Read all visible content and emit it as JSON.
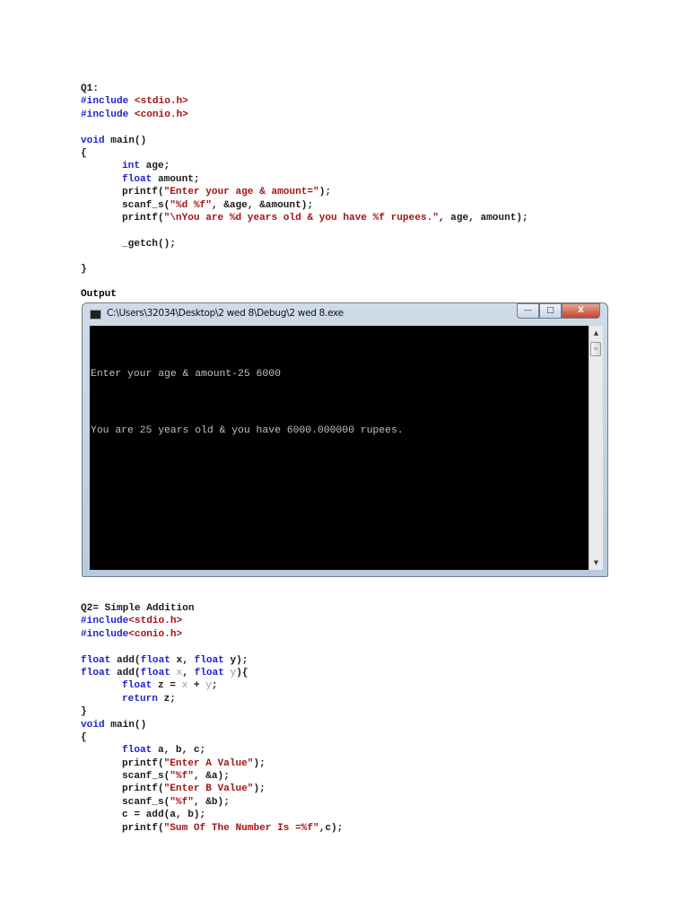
{
  "q1": {
    "lines": [
      [
        {
          "t": "Q1:",
          "c": "label"
        }
      ],
      [
        {
          "t": "#include ",
          "c": "kw"
        },
        {
          "t": "<stdio.h>",
          "c": "str"
        }
      ],
      [
        {
          "t": "#include ",
          "c": "kw"
        },
        {
          "t": "<conio.h>",
          "c": "str"
        }
      ],
      [],
      [
        {
          "t": "void",
          "c": "kw"
        },
        {
          "t": " main()",
          "c": ""
        }
      ],
      [
        {
          "t": "{",
          "c": ""
        }
      ],
      [
        {
          "t": "int",
          "c": "kw",
          "i": 1
        },
        {
          "t": " age;",
          "c": ""
        }
      ],
      [
        {
          "t": "float",
          "c": "kw",
          "i": 1
        },
        {
          "t": " amount;",
          "c": ""
        }
      ],
      [
        {
          "t": "printf(",
          "c": "",
          "i": 1
        },
        {
          "t": "\"Enter your age & amount=\"",
          "c": "str"
        },
        {
          "t": ");",
          "c": ""
        }
      ],
      [
        {
          "t": "scanf_s(",
          "c": "",
          "i": 1
        },
        {
          "t": "\"%d %f\"",
          "c": "str"
        },
        {
          "t": ", &age, &amount);",
          "c": ""
        }
      ],
      [
        {
          "t": "printf(",
          "c": "",
          "i": 1
        },
        {
          "t": "\"\\nYou are %d years old & you have %f rupees.\"",
          "c": "str"
        },
        {
          "t": ", age, amount);",
          "c": ""
        }
      ],
      [],
      [
        {
          "t": "_getch();",
          "c": "",
          "i": 1
        }
      ],
      [],
      [
        {
          "t": "}",
          "c": ""
        }
      ]
    ]
  },
  "output_label": "Output",
  "console_window": {
    "title": "C:\\Users\\32034\\Desktop\\2 wed 8\\Debug\\2 wed 8.exe",
    "minimize": "—",
    "maximize": "□",
    "close": "X",
    "output_lines": [
      "Enter your age & amount-25 6000",
      "You are 25 years old & you have 6000.000000 rupees."
    ],
    "scroll_up": "▲",
    "scroll_down": "▼",
    "thumb_grip": "≡"
  },
  "q2": {
    "lines": [
      [
        {
          "t": "Q2= Simple Addition",
          "c": "label"
        }
      ],
      [
        {
          "t": "#include",
          "c": "kw"
        },
        {
          "t": "<stdio.h>",
          "c": "str"
        }
      ],
      [
        {
          "t": "#include",
          "c": "kw"
        },
        {
          "t": "<conio.h>",
          "c": "str"
        }
      ],
      [],
      [
        {
          "t": "float",
          "c": "kw"
        },
        {
          "t": " add(",
          "c": ""
        },
        {
          "t": "float",
          "c": "kw"
        },
        {
          "t": " x, ",
          "c": ""
        },
        {
          "t": "float",
          "c": "kw"
        },
        {
          "t": " y);",
          "c": ""
        }
      ],
      [
        {
          "t": "float",
          "c": "kw"
        },
        {
          "t": " add(",
          "c": ""
        },
        {
          "t": "float",
          "c": "kw"
        },
        {
          "t": " ",
          "c": ""
        },
        {
          "t": "x",
          "c": "par"
        },
        {
          "t": ", ",
          "c": ""
        },
        {
          "t": "float",
          "c": "kw"
        },
        {
          "t": " ",
          "c": ""
        },
        {
          "t": "y",
          "c": "par"
        },
        {
          "t": "){",
          "c": ""
        }
      ],
      [
        {
          "t": "float",
          "c": "kw",
          "i": 1
        },
        {
          "t": " z = ",
          "c": ""
        },
        {
          "t": "x",
          "c": "par"
        },
        {
          "t": " + ",
          "c": ""
        },
        {
          "t": "y",
          "c": "par"
        },
        {
          "t": ";",
          "c": ""
        }
      ],
      [
        {
          "t": "return",
          "c": "kw",
          "i": 1
        },
        {
          "t": " z;",
          "c": ""
        }
      ],
      [
        {
          "t": "}",
          "c": ""
        }
      ],
      [
        {
          "t": "void",
          "c": "kw"
        },
        {
          "t": " main()",
          "c": ""
        }
      ],
      [
        {
          "t": "{",
          "c": ""
        }
      ],
      [
        {
          "t": "float",
          "c": "kw",
          "i": 1
        },
        {
          "t": " a, b, c;",
          "c": ""
        }
      ],
      [
        {
          "t": "printf(",
          "c": "",
          "i": 1
        },
        {
          "t": "\"Enter A Value\"",
          "c": "str"
        },
        {
          "t": ");",
          "c": ""
        }
      ],
      [
        {
          "t": "scanf_s(",
          "c": "",
          "i": 1
        },
        {
          "t": "\"%f\"",
          "c": "str"
        },
        {
          "t": ", &a);",
          "c": ""
        }
      ],
      [
        {
          "t": "printf(",
          "c": "",
          "i": 1
        },
        {
          "t": "\"Enter B Value\"",
          "c": "str"
        },
        {
          "t": ");",
          "c": ""
        }
      ],
      [
        {
          "t": "scanf_s(",
          "c": "",
          "i": 1
        },
        {
          "t": "\"%f\"",
          "c": "str"
        },
        {
          "t": ", &b);",
          "c": ""
        }
      ],
      [
        {
          "t": "c = add(a, b);",
          "c": "",
          "i": 1
        }
      ],
      [
        {
          "t": "printf(",
          "c": "",
          "i": 1
        },
        {
          "t": "\"Sum Of The Number Is =%f\"",
          "c": "str"
        },
        {
          "t": ",c);",
          "c": ""
        }
      ]
    ]
  }
}
